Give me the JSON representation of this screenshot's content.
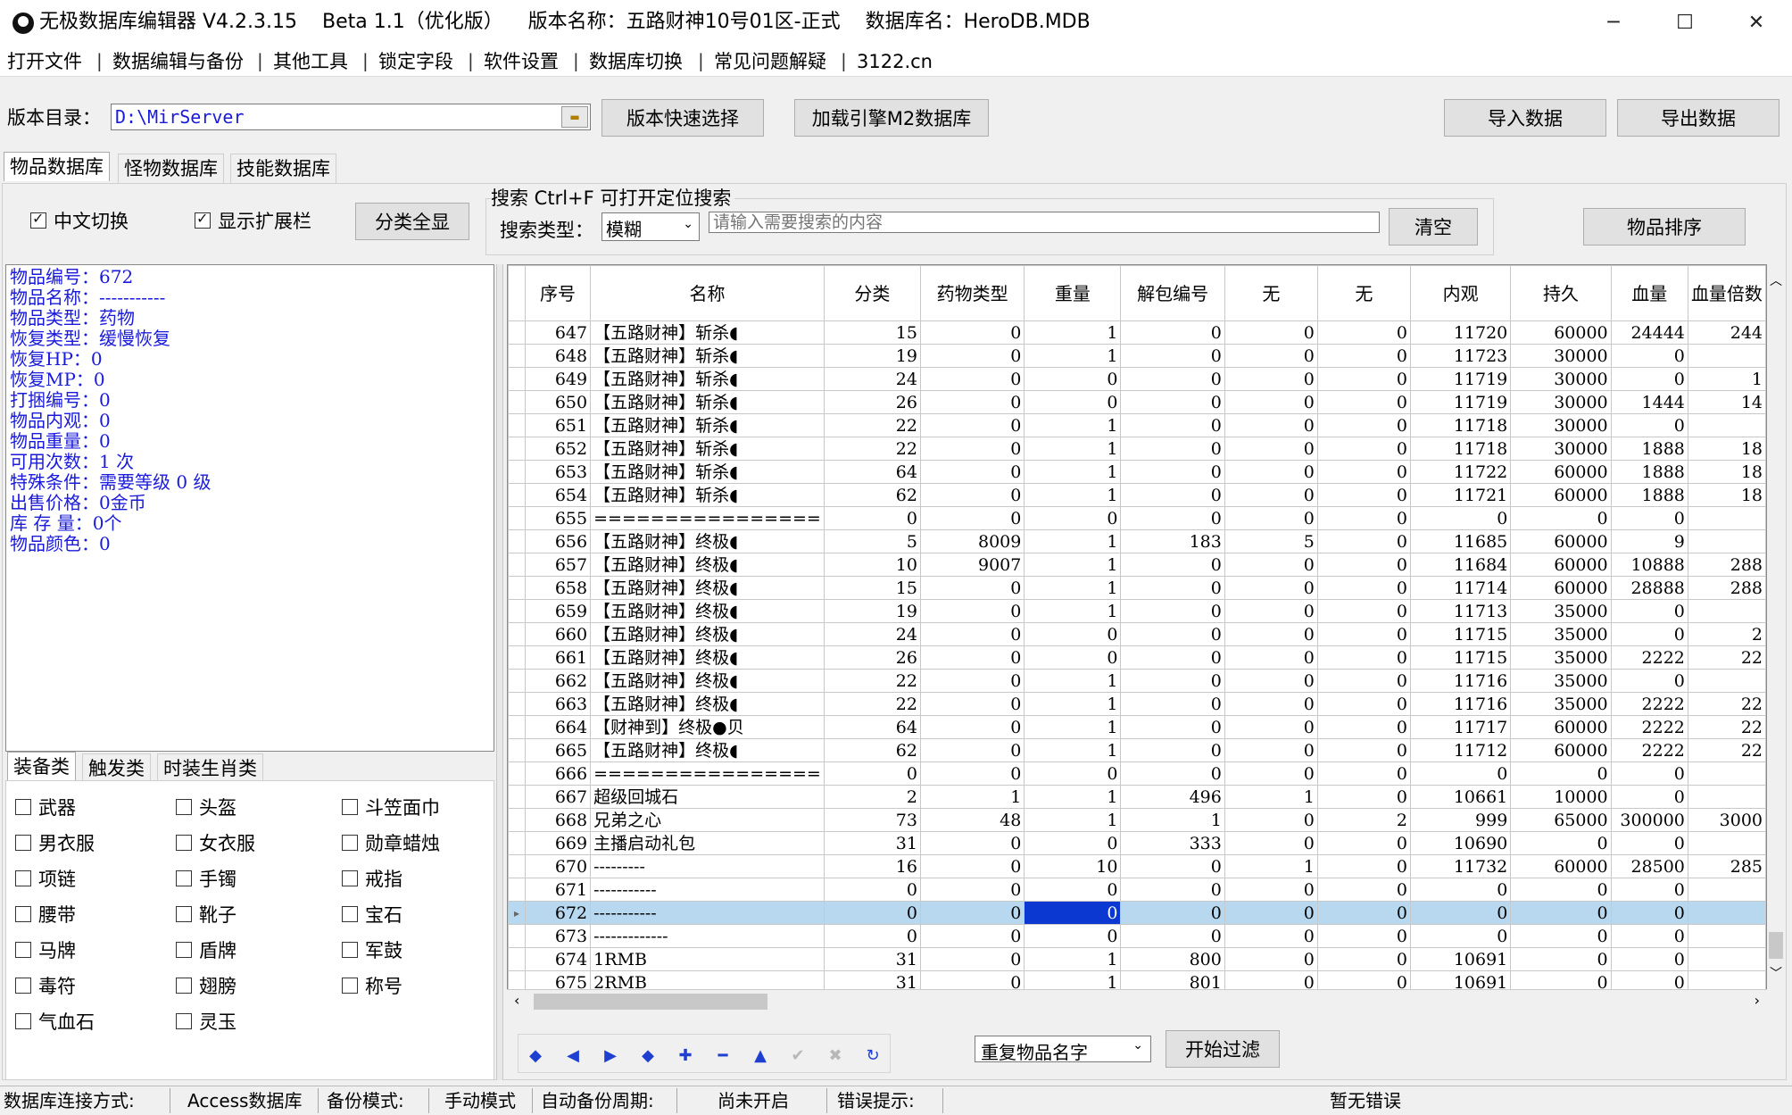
{
  "window": {
    "title": "无极数据库编辑器 V4.2.3.15    Beta 1.1（优化版）    版本名称：五路财神10号01区-正式    数据库名：HeroDB.MDB",
    "minimize": "─",
    "maximize": "☐",
    "close": "✕"
  },
  "menu": [
    "打开文件",
    "数据编辑与备份",
    "其他工具",
    "锁定字段",
    "软件设置",
    "数据库切换",
    "常见问题解疑",
    "3122.cn"
  ],
  "toolbar": {
    "dir_label": "版本目录：",
    "dir_value": "D:\\MirServer",
    "quick_select": "版本快速选择",
    "load_m2": "加载引擎M2数据库",
    "import": "导入数据",
    "export": "导出数据"
  },
  "db_tabs": [
    "物品数据库",
    "怪物数据库",
    "技能数据库"
  ],
  "options": {
    "chinese_toggle": "中文切换",
    "show_ext": "显示扩展栏",
    "show_all": "分类全显",
    "search_title": "搜索   Ctrl+F 可打开定位搜索",
    "search_type_label": "搜索类型：",
    "search_type_value": "模糊",
    "search_placeholder": "请输入需要搜索的内容",
    "clear": "清空",
    "sort": "物品排序"
  },
  "info_lines": [
    "物品编号：672",
    "物品名称：-----------",
    "物品类型：药物",
    "恢复类型：缓慢恢复",
    "恢复HP：0",
    "恢复MP：0",
    "打捆编号：0",
    "物品内观：0",
    "物品重量：0",
    "可用次数：1 次",
    "特殊条件：需要等级 0 级",
    "出售价格：0金币",
    "库 存 量：0个",
    "物品颜色：0"
  ],
  "cat_tabs": [
    "装备类",
    "触发类",
    "时装生肖类"
  ],
  "categories": [
    "武器",
    "头盔",
    "斗笠面巾",
    "男衣服",
    "女衣服",
    "勋章蜡烛",
    "项链",
    "手镯",
    "戒指",
    "腰带",
    "靴子",
    "宝石",
    "马牌",
    "盾牌",
    "军鼓",
    "毒符",
    "翅膀",
    "称号",
    "气血石",
    "灵玉"
  ],
  "grid": {
    "headers": [
      "序号",
      "名称",
      "分类",
      "药物类型",
      "重量",
      "解包编号",
      "无",
      "无",
      "内观",
      "持久",
      "血量",
      "血量倍数"
    ],
    "rows": [
      [
        "647",
        "【五路财神】斩杀◖",
        "15",
        "0",
        "1",
        "0",
        "0",
        "0",
        "11720",
        "60000",
        "24444",
        "244"
      ],
      [
        "648",
        "【五路财神】斩杀◖",
        "19",
        "0",
        "1",
        "0",
        "0",
        "0",
        "11723",
        "30000",
        "0",
        ""
      ],
      [
        "649",
        "【五路财神】斩杀◖",
        "24",
        "0",
        "0",
        "0",
        "0",
        "0",
        "11719",
        "30000",
        "0",
        "1"
      ],
      [
        "650",
        "【五路财神】斩杀◖",
        "26",
        "0",
        "0",
        "0",
        "0",
        "0",
        "11719",
        "30000",
        "1444",
        "14"
      ],
      [
        "651",
        "【五路财神】斩杀◖",
        "22",
        "0",
        "1",
        "0",
        "0",
        "0",
        "11718",
        "30000",
        "0",
        ""
      ],
      [
        "652",
        "【五路财神】斩杀◖",
        "22",
        "0",
        "1",
        "0",
        "0",
        "0",
        "11718",
        "30000",
        "1888",
        "18"
      ],
      [
        "653",
        "【五路财神】斩杀◖",
        "64",
        "0",
        "1",
        "0",
        "0",
        "0",
        "11722",
        "60000",
        "1888",
        "18"
      ],
      [
        "654",
        "【五路财神】斩杀◖",
        "62",
        "0",
        "1",
        "0",
        "0",
        "0",
        "11721",
        "60000",
        "1888",
        "18"
      ],
      [
        "655",
        "================",
        "0",
        "0",
        "0",
        "0",
        "0",
        "0",
        "0",
        "0",
        "0",
        ""
      ],
      [
        "656",
        "【五路财神】终极◖",
        "5",
        "8009",
        "1",
        "183",
        "5",
        "0",
        "11685",
        "60000",
        "9",
        ""
      ],
      [
        "657",
        "【五路财神】终极◖",
        "10",
        "9007",
        "1",
        "0",
        "0",
        "0",
        "11684",
        "60000",
        "10888",
        "288"
      ],
      [
        "658",
        "【五路财神】终极◖",
        "15",
        "0",
        "1",
        "0",
        "0",
        "0",
        "11714",
        "60000",
        "28888",
        "288"
      ],
      [
        "659",
        "【五路财神】终极◖",
        "19",
        "0",
        "1",
        "0",
        "0",
        "0",
        "11713",
        "35000",
        "0",
        ""
      ],
      [
        "660",
        "【五路财神】终极◖",
        "24",
        "0",
        "0",
        "0",
        "0",
        "0",
        "11715",
        "35000",
        "0",
        "2"
      ],
      [
        "661",
        "【五路财神】终极◖",
        "26",
        "0",
        "0",
        "0",
        "0",
        "0",
        "11715",
        "35000",
        "2222",
        "22"
      ],
      [
        "662",
        "【五路财神】终极◖",
        "22",
        "0",
        "1",
        "0",
        "0",
        "0",
        "11716",
        "35000",
        "0",
        ""
      ],
      [
        "663",
        "【五路财神】终极◖",
        "22",
        "0",
        "1",
        "0",
        "0",
        "0",
        "11716",
        "35000",
        "2222",
        "22"
      ],
      [
        "664",
        "【财神到】终极●贝",
        "64",
        "0",
        "1",
        "0",
        "0",
        "0",
        "11717",
        "60000",
        "2222",
        "22"
      ],
      [
        "665",
        "【五路财神】终极◖",
        "62",
        "0",
        "1",
        "0",
        "0",
        "0",
        "11712",
        "60000",
        "2222",
        "22"
      ],
      [
        "666",
        "================",
        "0",
        "0",
        "0",
        "0",
        "0",
        "0",
        "0",
        "0",
        "0",
        ""
      ],
      [
        "667",
        "超级回城石",
        "2",
        "1",
        "1",
        "496",
        "1",
        "0",
        "10661",
        "10000",
        "0",
        ""
      ],
      [
        "668",
        "兄弟之心",
        "73",
        "48",
        "1",
        "1",
        "0",
        "2",
        "999",
        "65000",
        "300000",
        "3000"
      ],
      [
        "669",
        "主播启动礼包",
        "31",
        "0",
        "0",
        "333",
        "0",
        "0",
        "10690",
        "0",
        "0",
        ""
      ],
      [
        "670",
        "---------",
        "16",
        "0",
        "10",
        "0",
        "1",
        "0",
        "11732",
        "60000",
        "28500",
        "285"
      ],
      [
        "671",
        "-----------",
        "0",
        "0",
        "0",
        "0",
        "0",
        "0",
        "0",
        "0",
        "0",
        ""
      ],
      [
        "672",
        "-----------",
        "0",
        "0",
        "0",
        "0",
        "0",
        "0",
        "0",
        "0",
        "0",
        ""
      ],
      [
        "673",
        "-------------",
        "0",
        "0",
        "0",
        "0",
        "0",
        "0",
        "0",
        "0",
        "0",
        ""
      ],
      [
        "674",
        "1RMB",
        "31",
        "0",
        "1",
        "800",
        "0",
        "0",
        "10691",
        "0",
        "0",
        ""
      ],
      [
        "675",
        "2RMB",
        "31",
        "0",
        "1",
        "801",
        "0",
        "0",
        "10691",
        "0",
        "0",
        ""
      ]
    ],
    "selected_row": "672"
  },
  "bottom": {
    "nav_icons": [
      "first-icon",
      "prev-icon",
      "next-icon",
      "last-icon",
      "add-icon",
      "delete-icon",
      "up-icon",
      "confirm-icon",
      "cancel-icon",
      "refresh-icon"
    ],
    "nav_glyphs": [
      "◆",
      "◀",
      "▶",
      "◆",
      "✚",
      "━",
      "▲",
      "✔",
      "✖",
      "↻"
    ],
    "filter_value": "重复物品名字",
    "filter_button": "开始过滤"
  },
  "status": {
    "conn_label": "数据库连接方式:",
    "conn_value": "Access数据库",
    "backup_label": "备份模式:",
    "backup_value": "手动模式",
    "auto_label": "自动备份周期:",
    "auto_value": "尚未开启",
    "err_label": "错误提示:",
    "err_value": "暂无错误"
  }
}
